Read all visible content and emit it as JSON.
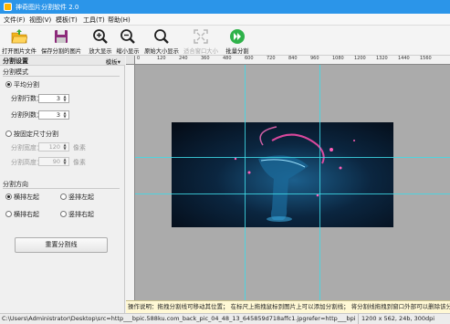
{
  "window": {
    "title": "神奇图片分割软件 2.0"
  },
  "menu": [
    "文件(F)",
    "视图(V)",
    "模板(T)",
    "工具(T)",
    "帮助(H)"
  ],
  "toolbar": {
    "open": "打开图片文件",
    "save": "保存分割的图片",
    "zoom_in": "放大显示",
    "zoom_out": "缩小显示",
    "actual_size": "原始大小显示",
    "fit_window": "适合窗口大小",
    "batch": "批量分割"
  },
  "panel": {
    "title": "分割设置",
    "template": "模板▾",
    "mode_section": "分割模式",
    "equal_split": "平均分割",
    "rows_label": "分割行数：",
    "rows_value": "3",
    "cols_label": "分割列数：",
    "cols_value": "3",
    "fixed_split": "按固定尺寸分割",
    "width_label": "分割宽度：",
    "width_value": "120",
    "height_label": "分割高度：",
    "height_value": "90",
    "px_unit": "像素",
    "direction_section": "分割方向",
    "dir_h_left": "横排左起",
    "dir_v_left": "竖排左起",
    "dir_h_right": "横排右起",
    "dir_v_right": "竖排右起",
    "reset_button": "重置分割线"
  },
  "ruler_ticks": [
    "0",
    "120",
    "240",
    "360",
    "480",
    "600",
    "720",
    "840",
    "960",
    "1080",
    "1200",
    "1320",
    "1440",
    "1560"
  ],
  "hint": "操作说明：拖拽分割线可移动其位置； 在标尺上拖拽鼠标到图片上可以添加分割线； 将分割线拖拽到窗口外部可以删除该分割线",
  "status": {
    "path": "C:\\Users\\Administrator\\Desktop\\src=http___bpic.588ku.com_back_pic_04_48_13_645859d718affc1.jpgrefer=http___bpic.588ku.jpg",
    "info": "1200 x 562, 24b, 300dpi"
  },
  "colors": {
    "titlebar": "#2b95e9",
    "guide": "#3fd9e6"
  }
}
